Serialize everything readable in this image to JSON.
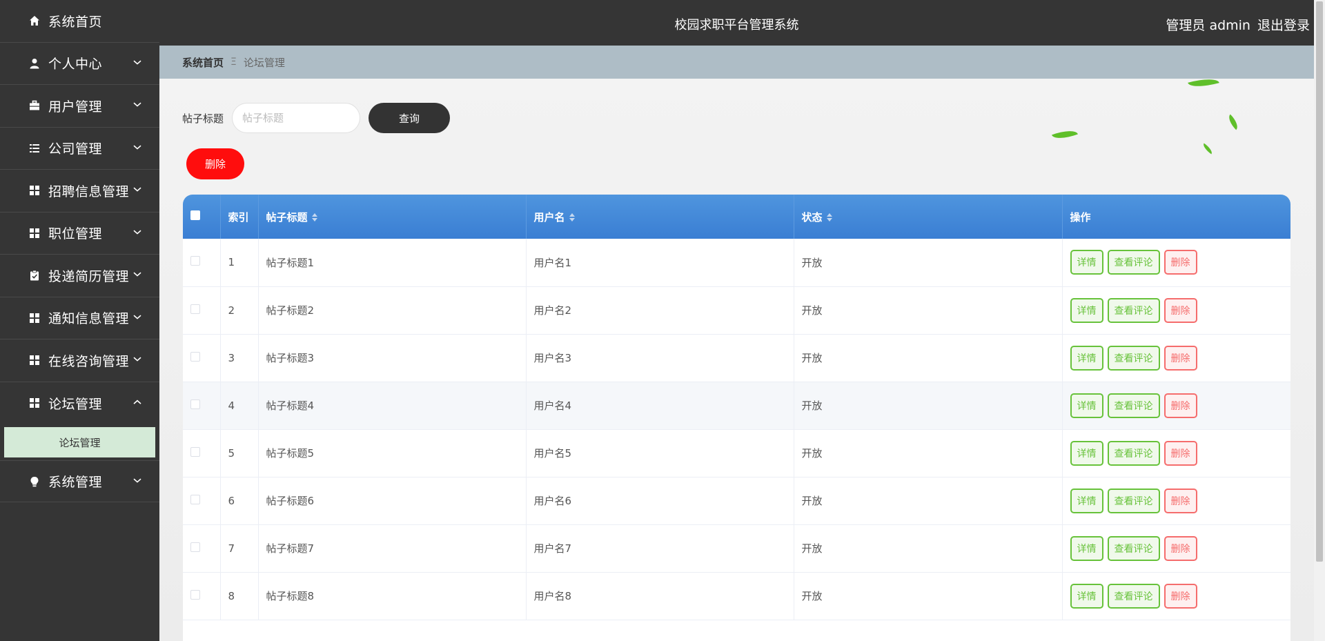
{
  "sidebar": {
    "items": [
      {
        "label": "系统首页",
        "icon": "home-icon"
      },
      {
        "label": "个人中心",
        "icon": "user-icon"
      },
      {
        "label": "用户管理",
        "icon": "briefcase-icon"
      },
      {
        "label": "公司管理",
        "icon": "list-icon"
      },
      {
        "label": "招聘信息管理",
        "icon": "grid-icon"
      },
      {
        "label": "职位管理",
        "icon": "grid-icon"
      },
      {
        "label": "投递简历管理",
        "icon": "clipboard-icon"
      },
      {
        "label": "通知信息管理",
        "icon": "grid-icon"
      },
      {
        "label": "在线咨询管理",
        "icon": "grid-icon"
      },
      {
        "label": "论坛管理",
        "icon": "grid-icon"
      },
      {
        "label": "系统管理",
        "icon": "bulb-icon"
      }
    ],
    "submenu_label": "论坛管理"
  },
  "header": {
    "title": "校园求职平台管理系统",
    "role": "管理员 admin",
    "logout": "退出登录"
  },
  "breadcrumb": {
    "home": "系统首页",
    "separator": "Ξ",
    "current": "论坛管理"
  },
  "search": {
    "label": "帖子标题",
    "placeholder": "帖子标题",
    "value": "",
    "button": "查询"
  },
  "batch_delete": "删除",
  "table": {
    "columns": [
      "索引",
      "帖子标题",
      "用户名",
      "状态",
      "操作"
    ],
    "rows": [
      {
        "index": "1",
        "title": "帖子标题1",
        "user": "用户名1",
        "status": "开放"
      },
      {
        "index": "2",
        "title": "帖子标题2",
        "user": "用户名2",
        "status": "开放"
      },
      {
        "index": "3",
        "title": "帖子标题3",
        "user": "用户名3",
        "status": "开放"
      },
      {
        "index": "4",
        "title": "帖子标题4",
        "user": "用户名4",
        "status": "开放"
      },
      {
        "index": "5",
        "title": "帖子标题5",
        "user": "用户名5",
        "status": "开放"
      },
      {
        "index": "6",
        "title": "帖子标题6",
        "user": "用户名6",
        "status": "开放"
      },
      {
        "index": "7",
        "title": "帖子标题7",
        "user": "用户名7",
        "status": "开放"
      },
      {
        "index": "8",
        "title": "帖子标题8",
        "user": "用户名8",
        "status": "开放"
      }
    ],
    "actions": {
      "detail": "详情",
      "comments": "查看评论",
      "delete": "删除"
    }
  },
  "colors": {
    "sidebar_bg": "#353535",
    "header_bg": "#353535",
    "breadcrumb_bg": "#aebdc6",
    "table_header": "#4f95de",
    "active_submenu": "#d4ead7",
    "delete_red": "#ff0d0d",
    "success_green": "#67c23a"
  }
}
